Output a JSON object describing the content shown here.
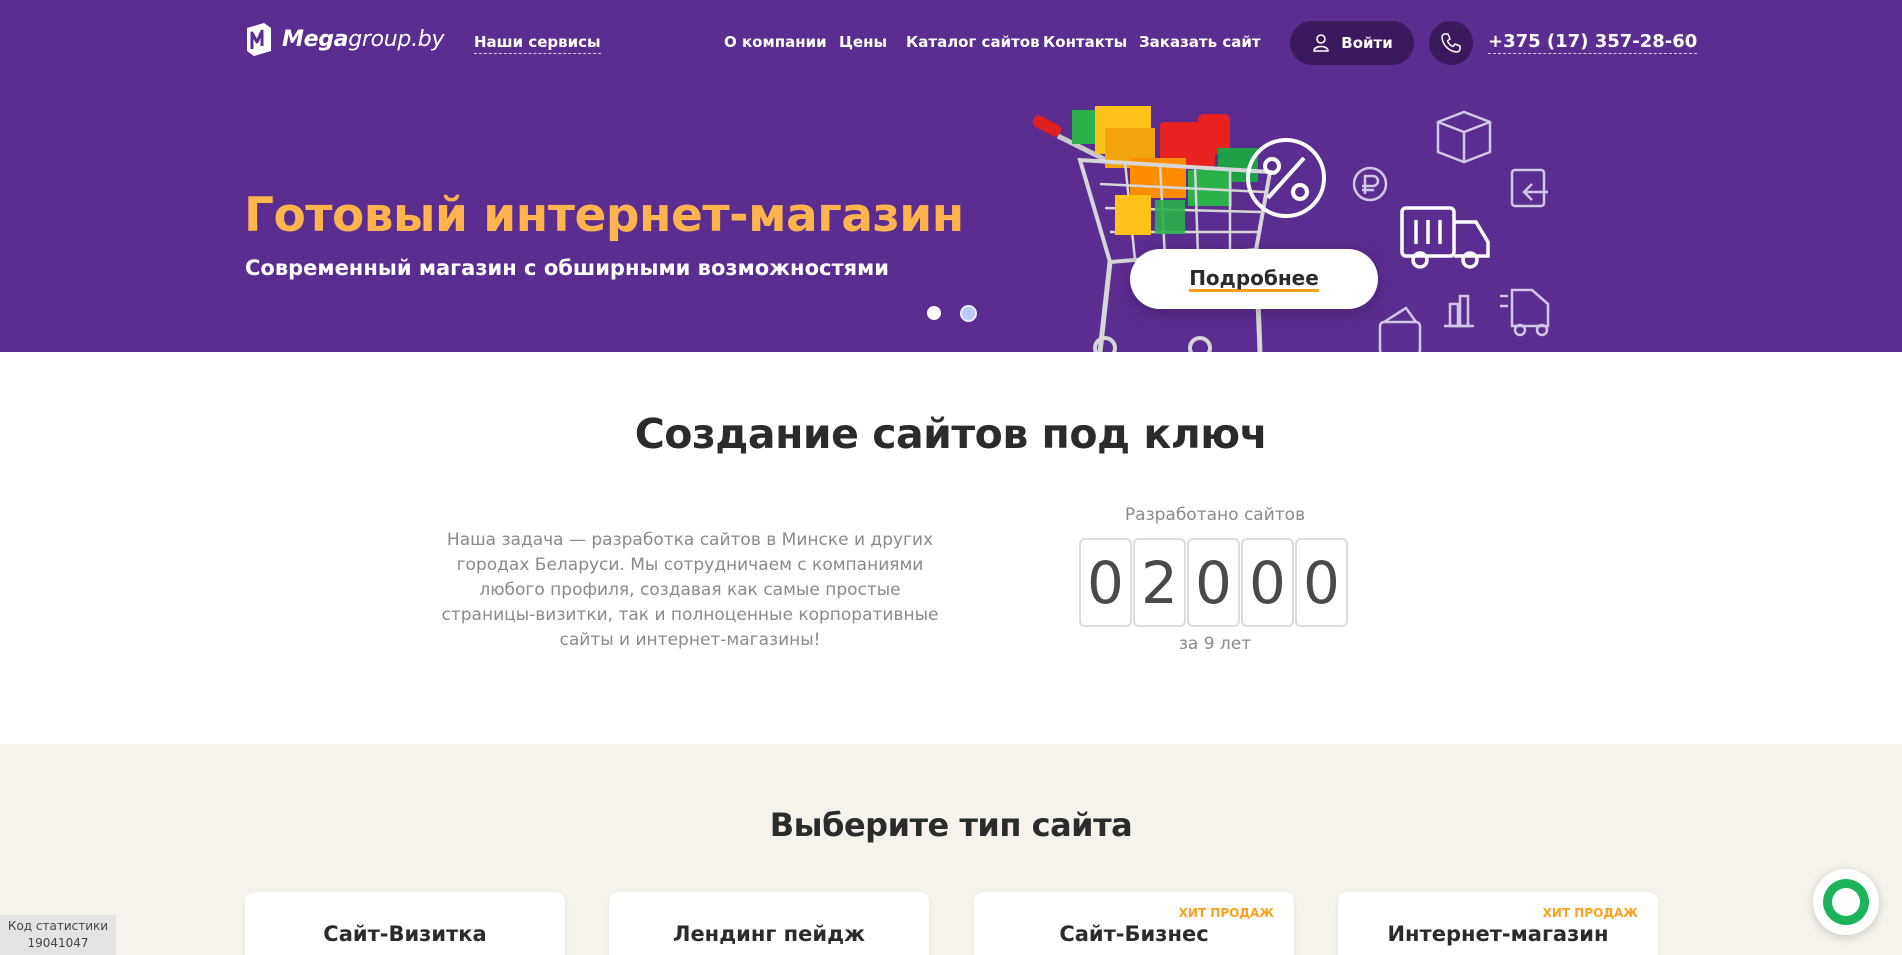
{
  "header": {
    "logo_bold": "Mega",
    "logo_light": "group.by",
    "services": "Наши сервисы",
    "nav": [
      "О компании",
      "Цены",
      "Каталог сайтов",
      "Контакты",
      "Заказать сайт"
    ],
    "login": "Войти",
    "phone": "+375 (17) 357-28-60"
  },
  "hero": {
    "title": "Готовый интернет-магазин",
    "subtitle": "Современный магазин с обширными возможностями",
    "details_button": "Подробнее",
    "slides_count": 2,
    "active_slide": 2
  },
  "about": {
    "title": "Создание сайтов под ключ",
    "description": "Наша задача — разработка сайтов в Минске и других городах Беларуси. Мы сотрудничаем с компаниями любого профиля, создавая как самые простые страницы-визитки, так и полноценные корпоративные сайты и интернет-магазины!",
    "counter_label": "Разработано сайтов",
    "counter_digits": [
      "0",
      "2",
      "0",
      "0",
      "0"
    ],
    "counter_sub": "за 9 лет"
  },
  "types": {
    "title": "Выберите тип сайта",
    "cards": [
      {
        "title": "Сайт-Визитка",
        "badge": ""
      },
      {
        "title": "Лендинг пейдж",
        "badge": ""
      },
      {
        "title": "Сайт-Бизнес",
        "badge": "ХИТ ПРОДАЖ"
      },
      {
        "title": "Интернет-магазин",
        "badge": "ХИТ ПРОДАЖ"
      }
    ]
  },
  "stats": {
    "label": "Код статистики",
    "code": "19041047"
  },
  "icons": [
    "logo-icon",
    "user-icon",
    "phone-icon",
    "shopping-cart-icon",
    "discount-icon",
    "ruble-coin-icon",
    "box-icon",
    "delivery-truck-icon",
    "return-icon",
    "chart-icon",
    "forklift-icon",
    "wallet-icon",
    "chat-icon"
  ],
  "colors": {
    "hero_bg": "#5c2d91",
    "accent_orange": "#ffb44d",
    "badge_orange": "#ff9f1a",
    "types_bg": "#f6f3ec",
    "chat_green": "#1cb35a"
  }
}
